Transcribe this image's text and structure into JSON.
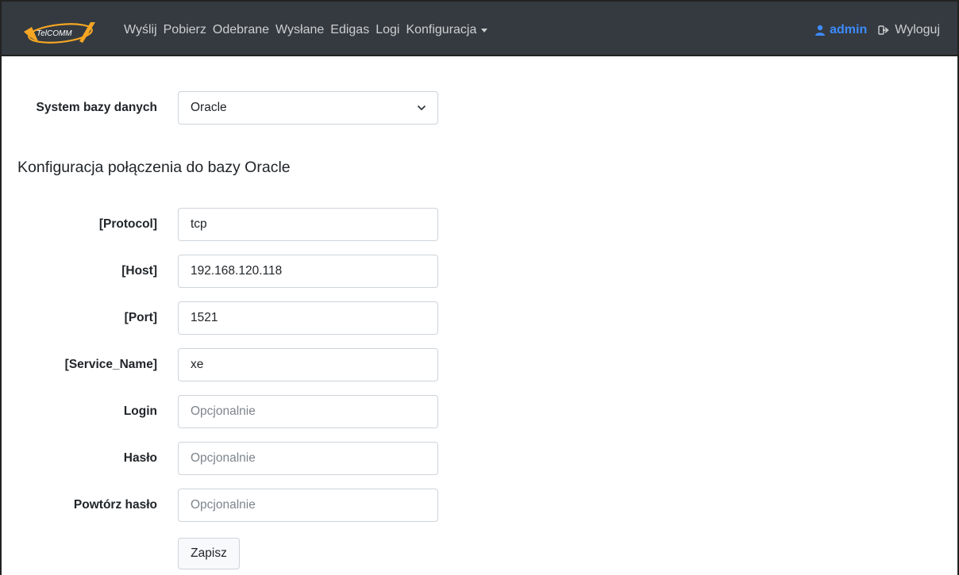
{
  "brand": {
    "logo_text": "TelCOMM"
  },
  "nav": {
    "items": [
      "Wyślij",
      "Pobierz",
      "Odebrane",
      "Wysłane",
      "Edigas",
      "Logi"
    ],
    "dropdown_label": "Konfiguracja",
    "user_label": "admin",
    "logout_label": "Wyloguj",
    "colors": {
      "background": "#343a40",
      "user": "#3d8bfd"
    }
  },
  "db_system": {
    "label": "System bazy danych",
    "selected": "Oracle"
  },
  "section_title": "Konfiguracja połączenia do bazy Oracle",
  "fields": [
    {
      "label": "[Protocol]",
      "value": "tcp",
      "placeholder": ""
    },
    {
      "label": "[Host]",
      "value": "192.168.120.118",
      "placeholder": ""
    },
    {
      "label": "[Port]",
      "value": "1521",
      "placeholder": ""
    },
    {
      "label": "[Service_Name]",
      "value": "xe",
      "placeholder": ""
    },
    {
      "label": "Login",
      "value": "",
      "placeholder": "Opcjonalnie"
    },
    {
      "label": "Hasło",
      "value": "",
      "placeholder": "Opcjonalnie"
    },
    {
      "label": "Powtórz hasło",
      "value": "",
      "placeholder": "Opcjonalnie"
    }
  ],
  "save_label": "Zapisz"
}
